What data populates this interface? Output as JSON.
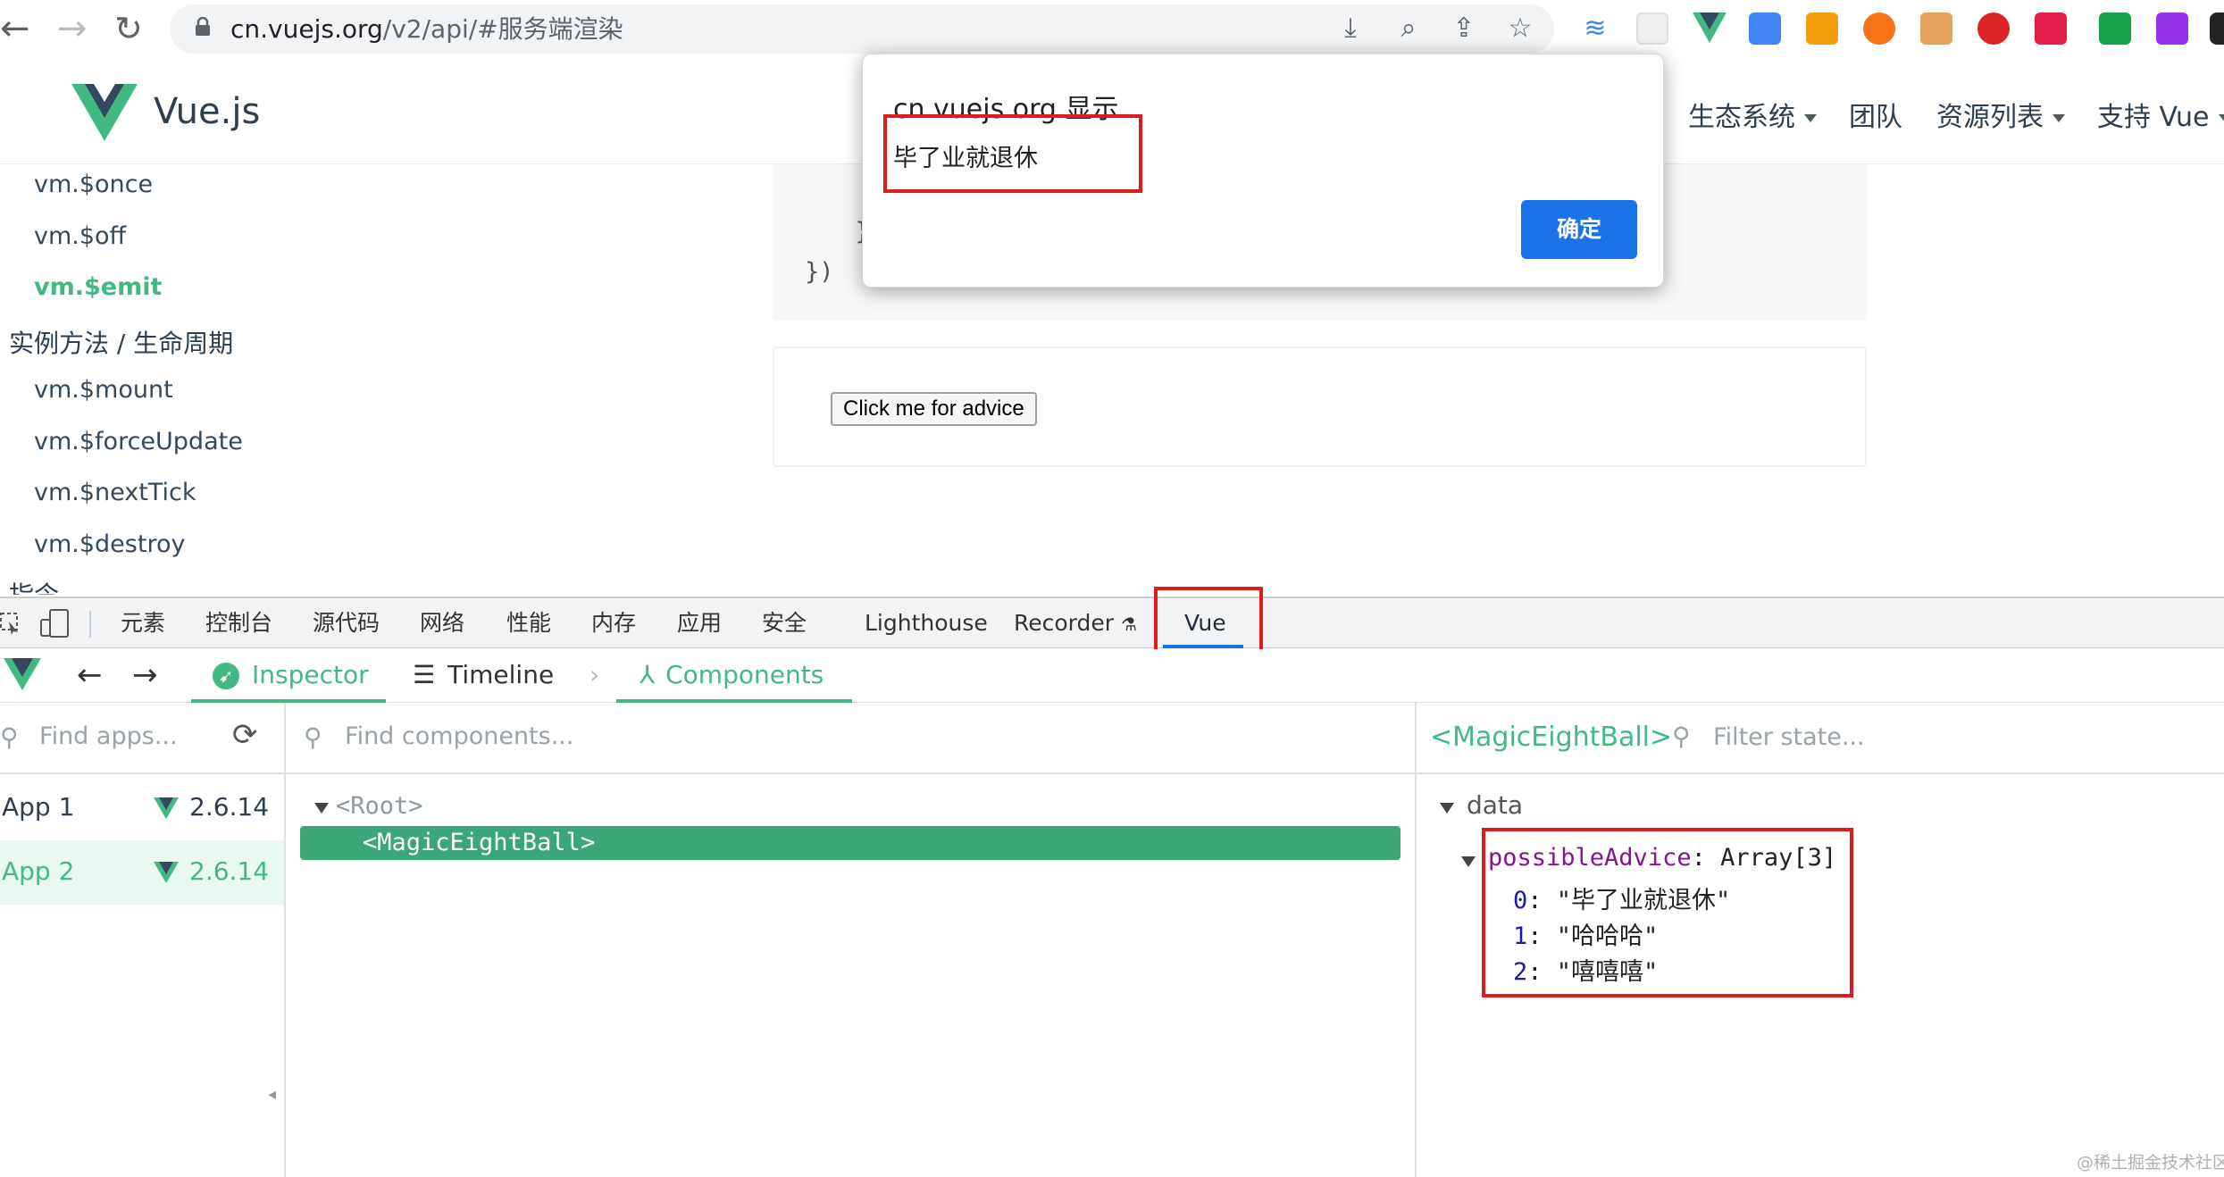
{
  "browser": {
    "url_host": "cn.vuejs.org",
    "url_path": "/v2/api/#服务端渲染"
  },
  "site": {
    "title": "Vue.js",
    "nav": [
      "生态系统",
      "团队",
      "资源列表",
      "支持 Vue"
    ]
  },
  "sidebar": {
    "items": [
      {
        "label": "vm.$once",
        "type": "item"
      },
      {
        "label": "vm.$off",
        "type": "item"
      },
      {
        "label": "vm.$emit",
        "type": "active"
      },
      {
        "label": "实例方法 / 生命周期",
        "type": "group"
      },
      {
        "label": "vm.$mount",
        "type": "item"
      },
      {
        "label": "vm.$forceUpdate",
        "type": "item"
      },
      {
        "label": "vm.$nextTick",
        "type": "item"
      },
      {
        "label": "vm.$destroy",
        "type": "item"
      },
      {
        "label": "指令",
        "type": "group"
      }
    ]
  },
  "code": {
    "lines": [
      "  }",
      "})"
    ]
  },
  "demo": {
    "button_label": "Click me for advice"
  },
  "alert": {
    "origin": "cn.vuejs.org 显示",
    "message": "毕了业就退休",
    "ok_label": "确定"
  },
  "devtools": {
    "tabs": [
      "元素",
      "控制台",
      "源代码",
      "网络",
      "性能",
      "内存",
      "应用",
      "安全",
      "Lighthouse",
      "Recorder",
      "Vue"
    ],
    "vue_bar": {
      "inspector": "Inspector",
      "timeline": "Timeline",
      "components": "Components"
    },
    "apps_search_placeholder": "Find apps...",
    "components_search_placeholder": "Find components...",
    "state_filter_placeholder": "Filter state...",
    "apps": [
      {
        "name": "App 1",
        "version": "2.6.14",
        "selected": false
      },
      {
        "name": "App 2",
        "version": "2.6.14",
        "selected": true
      }
    ],
    "tree": {
      "root": "<Root>",
      "selected": "<MagicEightBall>"
    },
    "state": {
      "component": "<MagicEightBall>",
      "section": "data",
      "key": "possibleAdvice",
      "type": "Array[3]",
      "items": [
        {
          "index": "0",
          "value": "\"毕了业就退休\""
        },
        {
          "index": "1",
          "value": "\"哈哈哈\""
        },
        {
          "index": "2",
          "value": "\"嘻嘻嘻\""
        }
      ]
    }
  },
  "watermark": "@稀土掘金技术社区",
  "colors": {
    "vue_green": "#42b983",
    "highlight_red": "#e01b1b",
    "chrome_blue": "#1a73e8"
  }
}
